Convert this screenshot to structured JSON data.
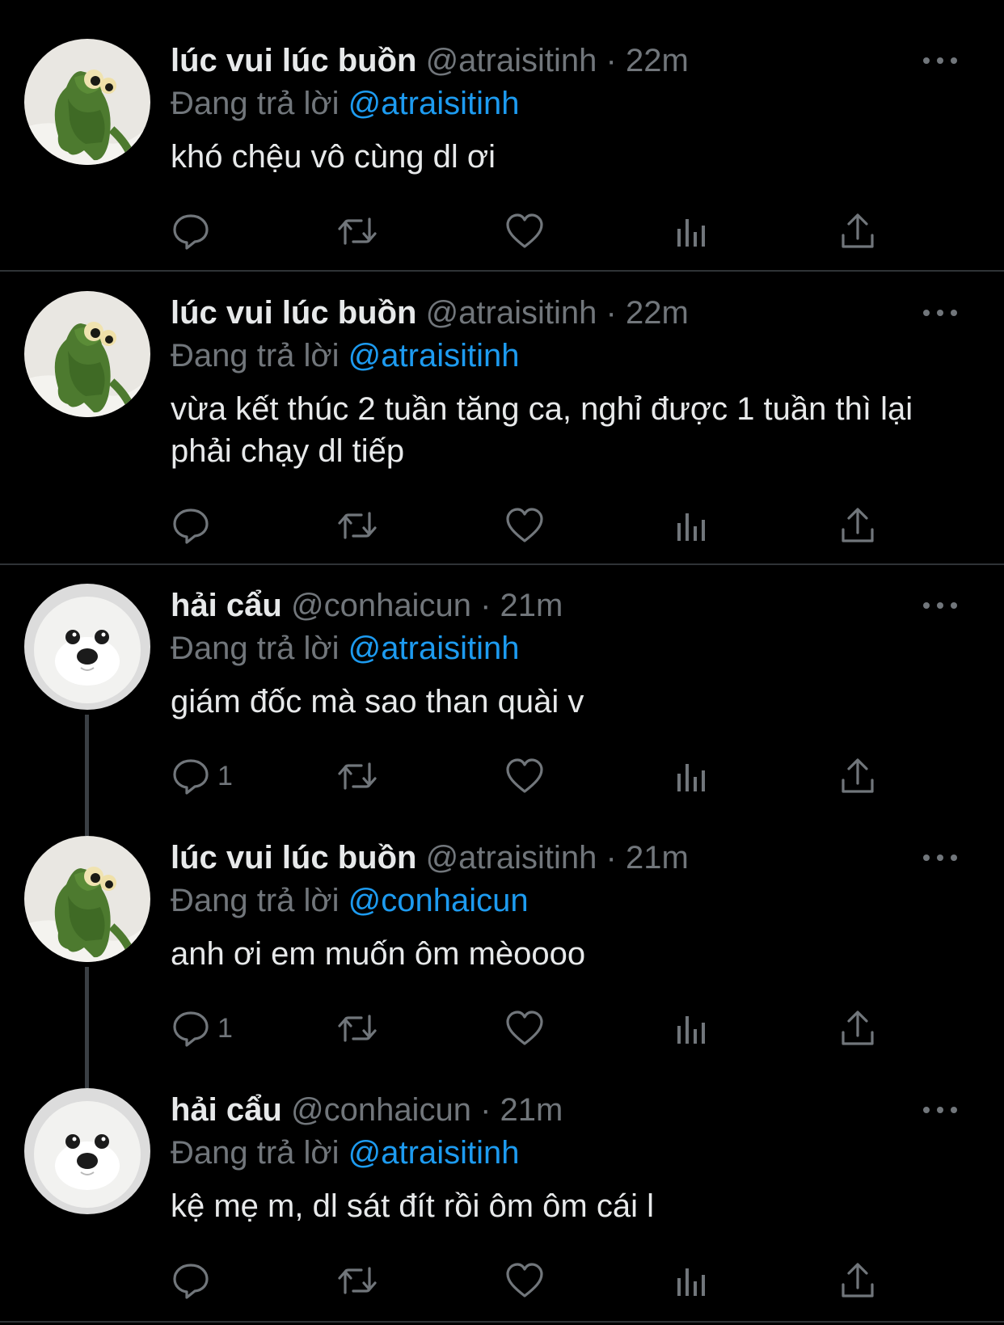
{
  "colors": {
    "background": "#000000",
    "primary_text": "#e7e9ea",
    "secondary_text": "#71767b",
    "mention_link": "#1d9bf0",
    "divider": "#2f3336"
  },
  "tweets": [
    {
      "avatar": "kermit-avatar",
      "name": "lúc vui lúc buồn",
      "handle": "@atraisitinh",
      "separator": "·",
      "time": "22m",
      "replying_prefix": "Đang trả lời",
      "replying_to": "@atraisitinh",
      "text": "khó chệu vô cùng dl ơi",
      "reply_count": ""
    },
    {
      "avatar": "kermit-avatar",
      "name": "lúc vui lúc buồn",
      "handle": "@atraisitinh",
      "separator": "·",
      "time": "22m",
      "replying_prefix": "Đang trả lời",
      "replying_to": "@atraisitinh",
      "text": "vừa kết thúc 2 tuần tăng ca, nghỉ được 1 tuần thì lại phải chạy dl tiếp",
      "reply_count": ""
    },
    {
      "avatar": "seal-avatar",
      "name": "hải cẩu",
      "handle": "@conhaicun",
      "separator": "·",
      "time": "21m",
      "replying_prefix": "Đang trả lời",
      "replying_to": "@atraisitinh",
      "text": "giám đốc mà sao than quài v",
      "reply_count": "1"
    },
    {
      "avatar": "kermit-avatar",
      "name": "lúc vui lúc buồn",
      "handle": "@atraisitinh",
      "separator": "·",
      "time": "21m",
      "replying_prefix": "Đang trả lời",
      "replying_to": "@conhaicun",
      "text": "anh ơi em muốn ôm mèoooo",
      "reply_count": "1"
    },
    {
      "avatar": "seal-avatar",
      "name": "hải cẩu",
      "handle": "@conhaicun",
      "separator": "·",
      "time": "21m",
      "replying_prefix": "Đang trả lời",
      "replying_to": "@atraisitinh",
      "text": "kệ mẹ m, dl sát đít rồi ôm ôm cái l",
      "reply_count": ""
    }
  ]
}
